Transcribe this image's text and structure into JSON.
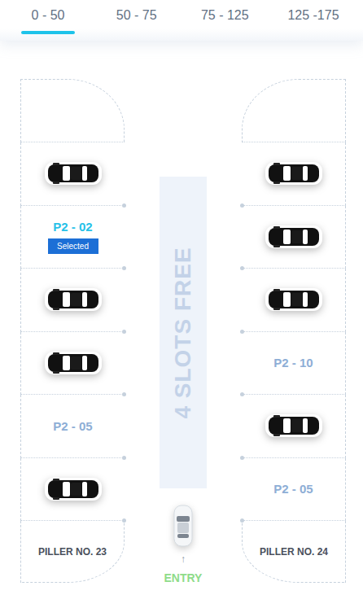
{
  "tabs": [
    {
      "label": "0 - 50",
      "selected": true
    },
    {
      "label": "50 - 75",
      "selected": false
    },
    {
      "label": "75 - 125",
      "selected": false
    },
    {
      "label": "125 -175",
      "selected": false
    }
  ],
  "left_slots": [
    {
      "kind": "occupied"
    },
    {
      "kind": "free",
      "label": "P2 - 02",
      "selected": true,
      "badge": "Selected"
    },
    {
      "kind": "occupied"
    },
    {
      "kind": "occupied"
    },
    {
      "kind": "free",
      "label": "P2 - 05",
      "selected": false
    },
    {
      "kind": "occupied"
    },
    {
      "kind": "pillar",
      "label": "PILLER NO. 23"
    }
  ],
  "right_slots": [
    {
      "kind": "occupied"
    },
    {
      "kind": "occupied"
    },
    {
      "kind": "occupied"
    },
    {
      "kind": "free",
      "label": "P2 - 10",
      "selected": false
    },
    {
      "kind": "occupied"
    },
    {
      "kind": "free",
      "label": "P2 - 05",
      "selected": false
    },
    {
      "kind": "pillar",
      "label": "PILLER NO. 24"
    }
  ],
  "free_banner": "4 SLOTS FREE",
  "entry": {
    "arrow": "↑",
    "label": "ENTRY"
  }
}
